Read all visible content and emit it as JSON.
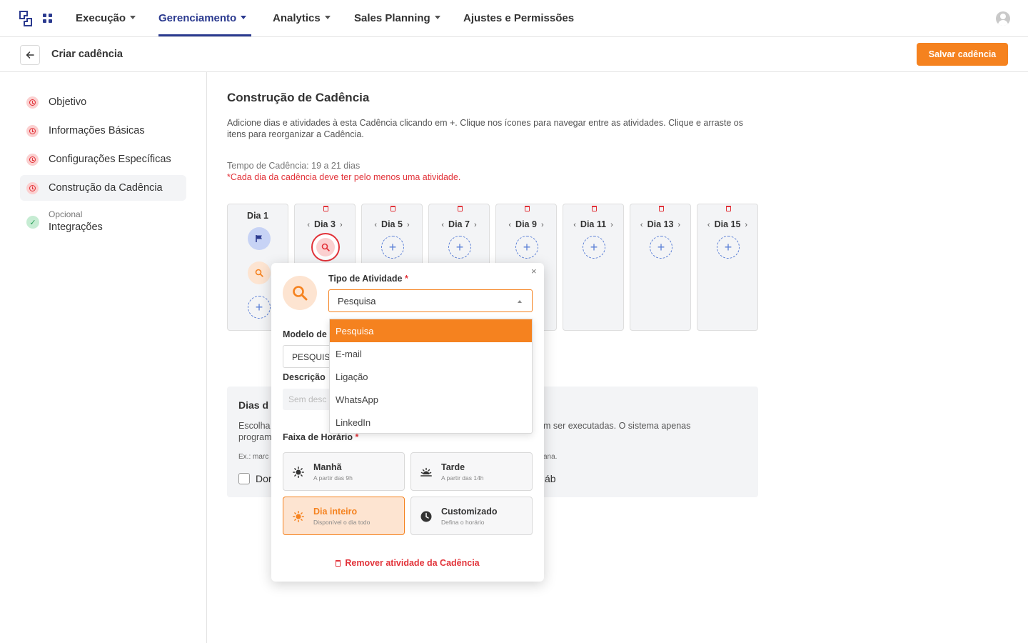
{
  "nav": {
    "items": [
      {
        "label": "Execução",
        "dropdown": true
      },
      {
        "label": "Gerenciamento",
        "dropdown": true,
        "active": true
      },
      {
        "label": "Analytics",
        "dropdown": true
      },
      {
        "label": "Sales Planning",
        "dropdown": true
      },
      {
        "label": "Ajustes e Permissões",
        "dropdown": false
      }
    ]
  },
  "subheader": {
    "title": "Criar cadência",
    "save_label": "Salvar cadência"
  },
  "sidebar": {
    "steps": [
      {
        "label": "Objetivo",
        "status": "error"
      },
      {
        "label": "Informações Básicas",
        "status": "error"
      },
      {
        "label": "Configurações Específicas",
        "status": "error"
      },
      {
        "label": "Construção da Cadência",
        "status": "error",
        "active": true
      }
    ],
    "optional_label": "Opcional",
    "optional_step": "Integrações"
  },
  "main": {
    "title": "Construção de Cadência",
    "description": "Adicione dias e atividades à esta Cadência clicando em +. Clique nos ícones para navegar entre as atividades. Clique e arraste os itens para reorganizar a Cadência.",
    "tempo": "Tempo de Cadência: 19 a 21 dias",
    "warning": "*Cada dia da cadência deve ter pelo menos uma atividade."
  },
  "days": [
    {
      "label": "Dia 1"
    },
    {
      "label": "Dia 3"
    },
    {
      "label": "Dia 5"
    },
    {
      "label": "Dia 7"
    },
    {
      "label": "Dia 9"
    },
    {
      "label": "Dia 11"
    },
    {
      "label": "Dia 13"
    },
    {
      "label": "Dia 15"
    }
  ],
  "dias_card": {
    "title": "Dias d",
    "text1": "Escolha",
    "text2": "program",
    "text_right": "m ser executadas. O sistema apenas",
    "example": "Ex.: marc",
    "example_right": "ana.",
    "cb_left": "Dor",
    "cb_right": "áb"
  },
  "popover": {
    "close": "×",
    "tipo_label": "Tipo de Atividade",
    "required": "*",
    "tipo_value": "Pesquisa",
    "modelo_label": "Modelo de",
    "modelo_value": "PESQUISA",
    "descricao_label": "Descrição",
    "descricao_placeholder": "Sem desc",
    "faixa_label": "Faixa de Horário",
    "slots": [
      {
        "title": "Manhã",
        "sub": "A partir das 9h"
      },
      {
        "title": "Tarde",
        "sub": "A partir das 14h"
      },
      {
        "title": "Dia inteiro",
        "sub": "Disponível o dia todo",
        "selected": true
      },
      {
        "title": "Customizado",
        "sub": "Defina o horário"
      }
    ],
    "remove_label": "Remover atividade da Cadência"
  },
  "dropdown": {
    "options": [
      "Pesquisa",
      "E-mail",
      "Ligação",
      "WhatsApp",
      "LinkedIn"
    ],
    "highlighted": "Pesquisa"
  },
  "colors": {
    "brand": "#2b3a8f",
    "accent": "#f5821f",
    "error": "#e2333a",
    "info": "#5a7fd6"
  },
  "icons": {
    "logo": "logo-icon",
    "apps": "apps-grid-icon",
    "avatar": "user-avatar-icon",
    "back": "arrow-left-icon",
    "step_error": "clock-alert-icon",
    "step_ok": "check-icon",
    "trash": "trash-icon",
    "add": "plus-circle-icon",
    "flag": "flag-icon",
    "search": "search-icon"
  }
}
